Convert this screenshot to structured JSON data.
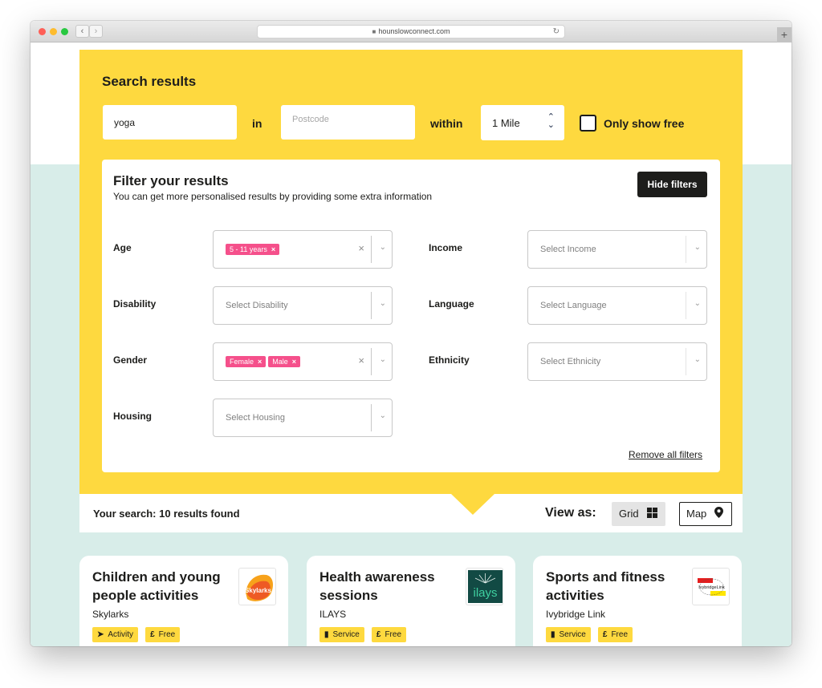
{
  "browser": {
    "url": "hounslowconnect.com",
    "back_glyph": "‹",
    "forward_glyph": "›",
    "lock_glyph": "🔒",
    "reload_glyph": "↻",
    "new_tab_glyph": "+"
  },
  "search": {
    "title": "Search results",
    "keyword_value": "yoga",
    "in_label": "in",
    "postcode_placeholder": "Postcode",
    "within_label": "within",
    "radius_value": "1 Mile",
    "only_free_label": "Only show free",
    "only_free_checked": false
  },
  "filters": {
    "title": "Filter your results",
    "subtitle": "You can get more personalised results by providing some extra information",
    "hide_button": "Hide filters",
    "remove_all": "Remove all filters",
    "age": {
      "label": "Age",
      "selected": [
        "5 - 11 years"
      ]
    },
    "disability": {
      "label": "Disability",
      "placeholder": "Select Disability"
    },
    "gender": {
      "label": "Gender",
      "selected": [
        "Female",
        "Male"
      ]
    },
    "housing": {
      "label": "Housing",
      "placeholder": "Select Housing"
    },
    "income": {
      "label": "Income",
      "placeholder": "Select Income"
    },
    "language": {
      "label": "Language",
      "placeholder": "Select Language"
    },
    "ethnicity": {
      "label": "Ethnicity",
      "placeholder": "Select Ethnicity"
    },
    "tag_remove_glyph": "×",
    "clear_glyph": "×",
    "chevron_glyph": "⌄"
  },
  "results": {
    "count_text": "Your search: 10 results found",
    "view_as_label": "View as:",
    "grid_label": "Grid",
    "map_label": "Map",
    "active_view": "Grid"
  },
  "cards": [
    {
      "title": "Children and young people activities",
      "org": "Skylarks",
      "logo": "skylarks-logo",
      "logo_text": "Skylarks",
      "badges": [
        {
          "icon": "paper-plane-icon",
          "glyph": "➤",
          "label": "Activity"
        },
        {
          "icon": "pound-icon",
          "glyph": "£",
          "label": "Free"
        }
      ]
    },
    {
      "title": "Health awareness sessions",
      "org": "ILAYS",
      "logo": "ilays-logo",
      "logo_text": "ilays",
      "badges": [
        {
          "icon": "clipboard-icon",
          "glyph": "▮",
          "label": "Service"
        },
        {
          "icon": "pound-icon",
          "glyph": "£",
          "label": "Free"
        }
      ]
    },
    {
      "title": "Sports and fitness activities",
      "org": "Ivybridge Link",
      "logo": "ivybridge-link-logo",
      "logo_text": "IvybridgeLink",
      "badges": [
        {
          "icon": "clipboard-icon",
          "glyph": "▮",
          "label": "Service"
        },
        {
          "icon": "pound-icon",
          "glyph": "£",
          "label": "Free"
        }
      ]
    }
  ],
  "colors": {
    "brand_yellow": "#fed93f",
    "mint_background": "#d8ede9",
    "tag_pink": "#f5508b",
    "dark": "#1d1d1b"
  }
}
